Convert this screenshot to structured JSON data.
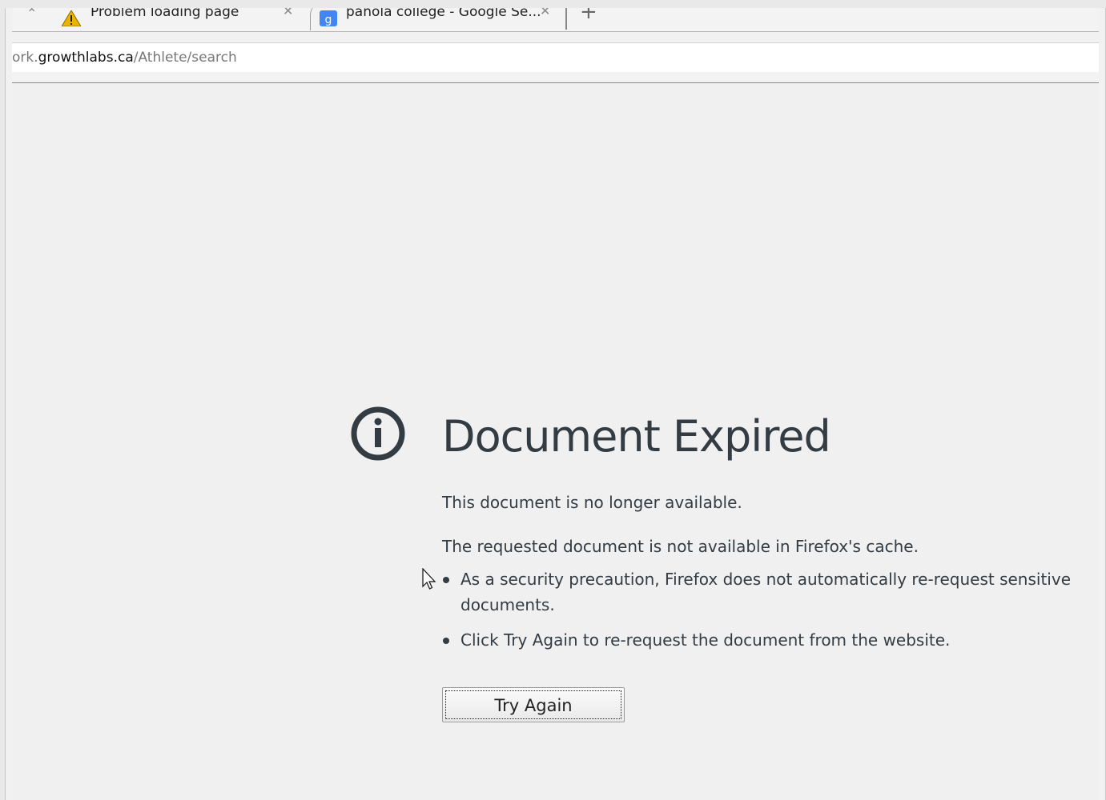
{
  "tabs": [
    {
      "label": "Problem loading page",
      "icon": "warning-icon",
      "active": true
    },
    {
      "label": "panola college - Google Se...",
      "icon": "google-icon",
      "active": false
    }
  ],
  "address_bar": {
    "prefix": "ork.",
    "domain": "growthlabs.ca",
    "path": "/Athlete/search"
  },
  "error_page": {
    "icon": "info-icon",
    "title": "Document Expired",
    "short_desc": "This document is no longer available.",
    "long_desc": "The requested document is not available in Firefox's cache.",
    "bullets": [
      "As a security precaution, Firefox does not automatically re-request sensitive documents.",
      "Click Try Again to re-request the document from the website."
    ],
    "button_label": "Try Again"
  },
  "colors": {
    "text": "#333b43",
    "page_bg": "#f0f0f0",
    "warning": "#e8b400",
    "google_blue": "#4285f4"
  }
}
